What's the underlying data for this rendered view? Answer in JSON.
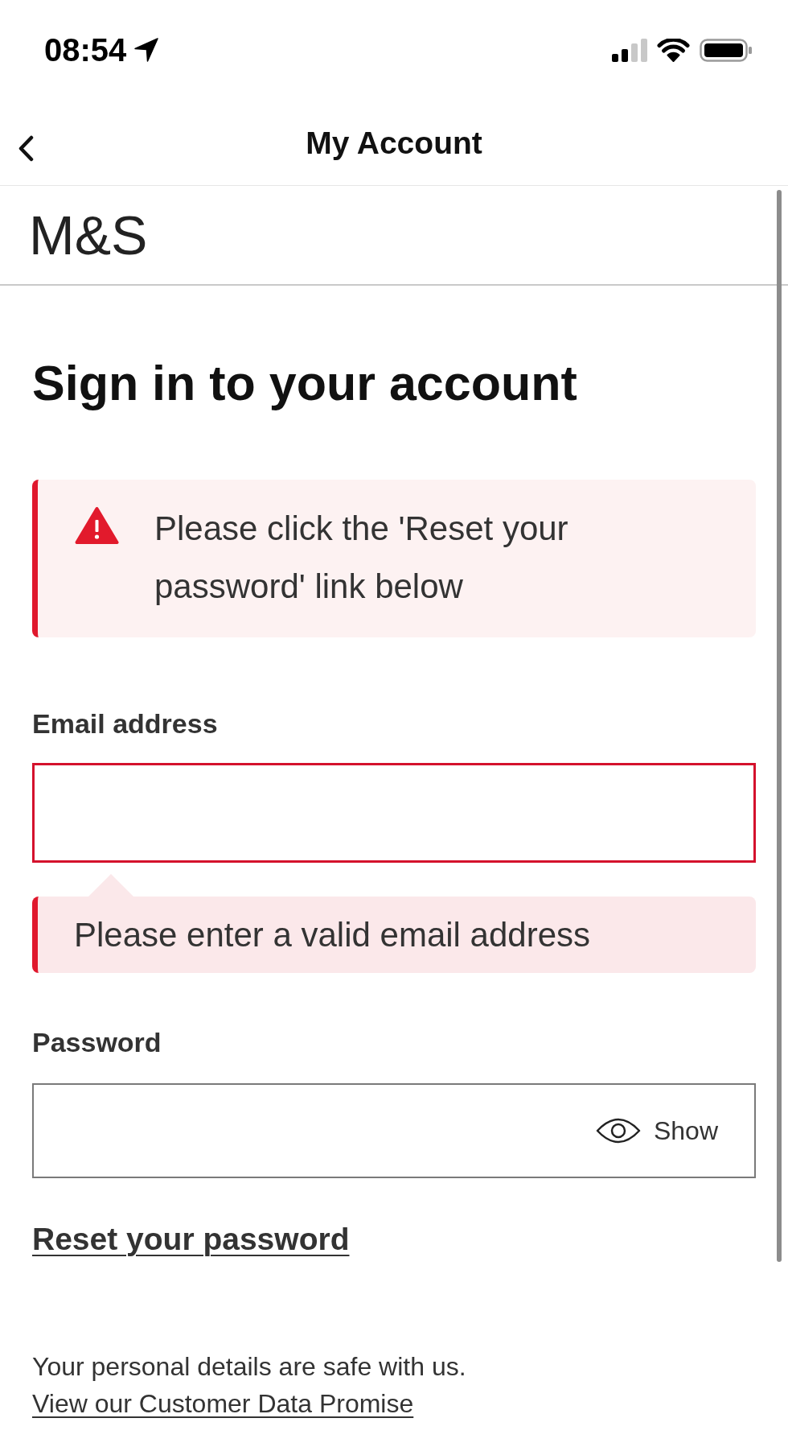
{
  "status_bar": {
    "time": "08:54"
  },
  "nav_bar": {
    "title": "My Account"
  },
  "brand": {
    "logo": "M&S"
  },
  "heading": "Sign in to your account",
  "alert": {
    "kind": "warning",
    "message": "Please click the 'Reset your password' link below"
  },
  "form": {
    "fields": [
      {
        "kind": "email",
        "label": "Email address",
        "invalid": true,
        "error": "Please enter a valid email address"
      },
      {
        "kind": "password",
        "label": "Password",
        "invalid": false,
        "toggle": "Show"
      }
    ]
  },
  "reset_link": "Reset your password",
  "footer": {
    "text": "Your personal details are safe with us.",
    "link": "View our Customer Data Promise"
  }
}
